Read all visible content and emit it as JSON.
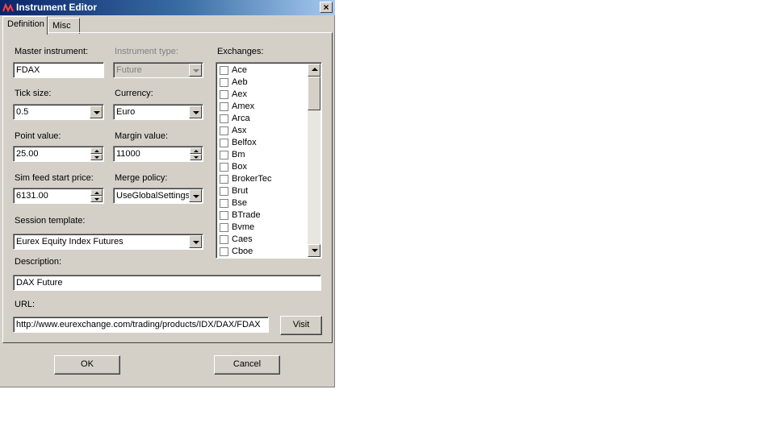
{
  "window": {
    "title": "Instrument Editor",
    "close_label": "×"
  },
  "tabs": [
    {
      "label": "Definition",
      "active": true
    },
    {
      "label": "Misc",
      "active": false
    }
  ],
  "form": {
    "master_instrument": {
      "label": "Master instrument:",
      "value": "FDAX"
    },
    "instrument_type": {
      "label": "Instrument type:",
      "value": "Future",
      "disabled": true
    },
    "tick_size": {
      "label": "Tick size:",
      "value": "0.5"
    },
    "currency": {
      "label": "Currency:",
      "value": "Euro"
    },
    "point_value": {
      "label": "Point value:",
      "value": "25.00"
    },
    "margin_value": {
      "label": "Margin value:",
      "value": "11000"
    },
    "sim_feed_start_price": {
      "label": "Sim feed start price:",
      "value": "6131.00"
    },
    "merge_policy": {
      "label": "Merge policy:",
      "value": "UseGlobalSettings"
    },
    "session_template": {
      "label": "Session template:",
      "value": "Eurex Equity Index Futures"
    },
    "description": {
      "label": "Description:",
      "value": "DAX Future"
    },
    "url": {
      "label": "URL:",
      "value": "http://www.eurexchange.com/trading/products/IDX/DAX/FDAX"
    },
    "visit_label": "Visit"
  },
  "exchanges": {
    "label": "Exchanges:",
    "items": [
      "Ace",
      "Aeb",
      "Aex",
      "Amex",
      "Arca",
      "Asx",
      "Belfox",
      "Bm",
      "Box",
      "BrokerTec",
      "Brut",
      "Bse",
      "BTrade",
      "Bvme",
      "Caes",
      "Cboe"
    ]
  },
  "footer": {
    "ok_label": "OK",
    "cancel_label": "Cancel"
  },
  "colors": {
    "window_bg": "#d4d0c8",
    "title_start": "#0a246a",
    "title_end": "#a6caf0"
  },
  "icons": {
    "app": "instrument-app-icon",
    "close": "close-icon"
  }
}
